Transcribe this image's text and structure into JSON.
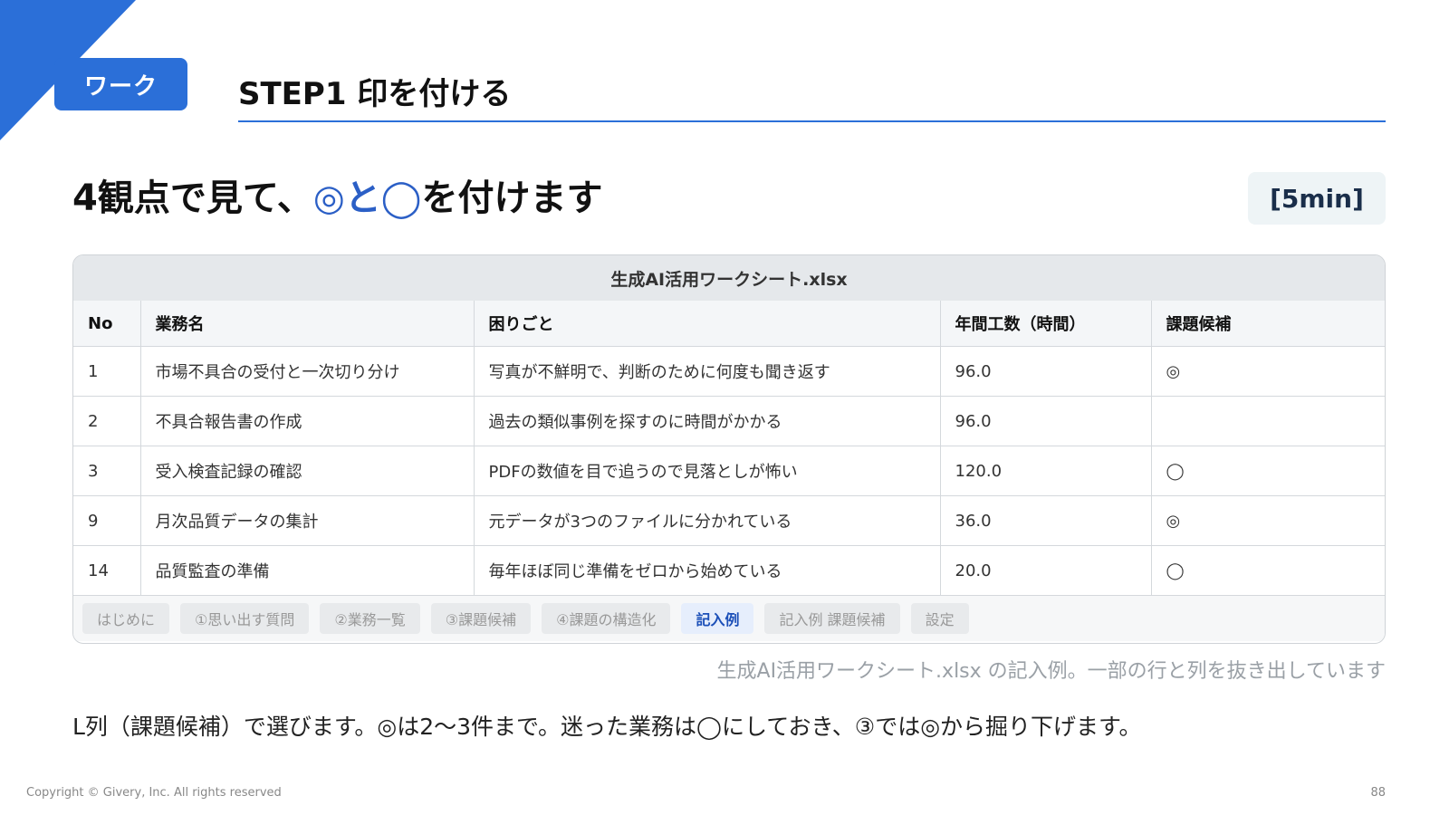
{
  "badge": {
    "label": "ワーク"
  },
  "step_title": "STEP1 印を付ける",
  "headline": {
    "prefix": "4観点で見て、",
    "accent": "◎と◯",
    "suffix": "を付けます"
  },
  "time_badge": "[5min]",
  "sheet": {
    "title": "生成AI活用ワークシート.xlsx",
    "columns": [
      "No",
      "業務名",
      "困りごと",
      "年間工数（時間）",
      "課題候補"
    ],
    "rows": [
      [
        "1",
        "市場不具合の受付と一次切り分け",
        "写真が不鮮明で、判断のために何度も聞き返す",
        "96.0",
        "◎"
      ],
      [
        "2",
        "不具合報告書の作成",
        "過去の類似事例を探すのに時間がかかる",
        "96.0",
        ""
      ],
      [
        "3",
        "受入検査記録の確認",
        "PDFの数値を目で追うので見落としが怖い",
        "120.0",
        "◯"
      ],
      [
        "9",
        "月次品質データの集計",
        "元データが3つのファイルに分かれている",
        "36.0",
        "◎"
      ],
      [
        "14",
        "品質監査の準備",
        "毎年ほぼ同じ準備をゼロから始めている",
        "20.0",
        "◯"
      ]
    ],
    "tabs": [
      "はじめに",
      "①思い出す質問",
      "②業務一覧",
      "③課題候補",
      "④課題の構造化",
      "記入例",
      "記入例 課題候補",
      "設定"
    ],
    "active_tab": "記入例"
  },
  "caption": "生成AI活用ワークシート.xlsx の記入例。一部の行と列を抜き出しています",
  "instruction": "L列（課題候補）で選びます。◎は2〜3件まで。迷った業務は◯にしておき、③では◎から掘り下げます。",
  "footer": {
    "copyright": "Copyright © Givery, Inc. All rights reserved",
    "page": "88"
  },
  "colors": {
    "accent": "#2b6fd8",
    "headline_accent": "#2b5fc6"
  }
}
